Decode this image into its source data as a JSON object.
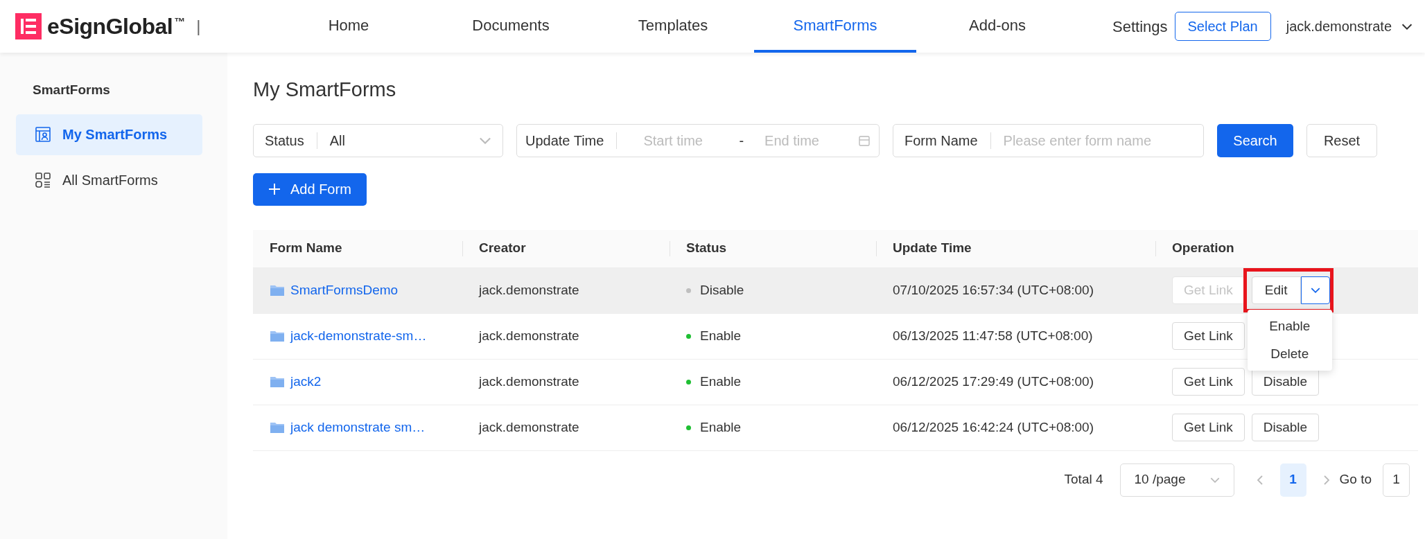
{
  "header": {
    "brand": "eSignGlobal",
    "trademark": "™",
    "separator": "|",
    "nav": [
      {
        "label": "Home",
        "selected": false
      },
      {
        "label": "Documents",
        "selected": false
      },
      {
        "label": "Templates",
        "selected": false
      },
      {
        "label": "SmartForms",
        "selected": true
      },
      {
        "label": "Add-ons",
        "selected": false
      }
    ],
    "settings": "Settings",
    "plan_button": "Select Plan",
    "user": "jack.demonstrate"
  },
  "sidebar": {
    "title": "SmartForms",
    "items": [
      {
        "label": "My SmartForms",
        "kind": "mine",
        "selected": true
      },
      {
        "label": "All SmartForms",
        "kind": "all",
        "selected": false
      }
    ]
  },
  "page_title": "My SmartForms",
  "filters": {
    "status": {
      "label": "Status",
      "value": "All"
    },
    "update_time": {
      "label": "Update Time",
      "start_placeholder": "Start time",
      "separator": "-",
      "end_placeholder": "End time"
    },
    "form_name": {
      "label": "Form Name",
      "placeholder": "Please enter form name"
    },
    "search_button": "Search",
    "reset_button": "Reset"
  },
  "add_button": "Add Form",
  "table": {
    "columns": [
      "Form Name",
      "Creator",
      "Status",
      "Update Time",
      "Operation"
    ],
    "rows": [
      {
        "name": "SmartFormsDemo",
        "creator": "jack.demonstrate",
        "status": "Disable",
        "color": "#bfbfbf",
        "time": "07/10/2025 16:57:34 (UTC+08:00)",
        "highlighted": true,
        "actions": [
          {
            "kind": "button",
            "label": "Get Link",
            "disabled": true
          },
          {
            "kind": "split",
            "label": "Edit",
            "expanded": true,
            "menu": [
              "Enable",
              "Delete"
            ]
          }
        ]
      },
      {
        "name": "jack-demonstrate-sm…",
        "creator": "jack.demonstrate",
        "status": "Enable",
        "color": "#1fbf33",
        "time": "06/13/2025 11:47:58 (UTC+08:00)",
        "highlighted": false,
        "actions": [
          {
            "kind": "button",
            "label": "Get Link",
            "disabled": false
          }
        ]
      },
      {
        "name": "jack2",
        "creator": "jack.demonstrate",
        "status": "Enable",
        "color": "#1fbf33",
        "time": "06/12/2025 17:29:49 (UTC+08:00)",
        "highlighted": false,
        "actions": [
          {
            "kind": "button",
            "label": "Get Link",
            "disabled": false
          },
          {
            "kind": "button",
            "label": "Disable",
            "disabled": false
          }
        ]
      },
      {
        "name": "jack demonstrate sm…",
        "creator": "jack.demonstrate",
        "status": "Enable",
        "color": "#1fbf33",
        "time": "06/12/2025 16:42:24 (UTC+08:00)",
        "highlighted": false,
        "actions": [
          {
            "kind": "button",
            "label": "Get Link",
            "disabled": false
          },
          {
            "kind": "button",
            "label": "Disable",
            "disabled": false
          }
        ]
      }
    ]
  },
  "pagination": {
    "total": "Total 4",
    "page_size": "10 /page",
    "pages": [
      {
        "label": "1",
        "selected": true
      }
    ],
    "goto_label": "Go to",
    "goto_value": "1"
  }
}
